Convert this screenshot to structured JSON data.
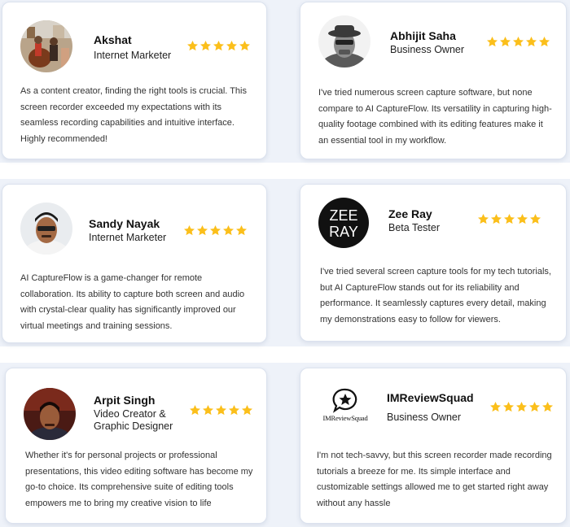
{
  "colors": {
    "star": "#fbbf1b",
    "band": "#eef2f9"
  },
  "testimonials": [
    {
      "name": "Akshat",
      "role": "Internet Marketer",
      "rating": 5,
      "text": "As a content creator, finding the right tools is crucial. This screen recorder exceeded my expectations with its seamless recording capabilities and intuitive interface. Highly recommended!"
    },
    {
      "name": "Abhijit Saha",
      "role": "Business Owner",
      "rating": 5,
      "text": "I've tried numerous screen capture software, but none compare to AI CaptureFlow. Its versatility in capturing high-quality footage combined with its editing features make it an essential tool in my workflow."
    },
    {
      "name": "Sandy Nayak",
      "role": "Internet Marketer",
      "rating": 5,
      "text": "AI CaptureFlow  is a game-changer for remote collaboration. Its ability to capture both screen and audio with crystal-clear quality has significantly improved our virtual meetings and training sessions."
    },
    {
      "name": "Zee Ray",
      "role": "Beta Tester",
      "rating": 5,
      "logo_text": [
        "ZEE",
        "RAY"
      ],
      "text": "I've tried several screen capture tools for my tech tutorials, but AI CaptureFlow stands out for its reliability and performance. It seamlessly captures every detail, making my demonstrations easy to follow for viewers."
    },
    {
      "name": "Arpit Singh",
      "role": "Video Creator & Graphic Designer",
      "rating": 5,
      "text": "Whether it's for personal projects or professional presentations, this video editing software has become my go-to choice. Its comprehensive suite of editing tools empowers me to bring my creative vision to life"
    },
    {
      "name": "IMReviewSquad",
      "role": "Business Owner",
      "rating": 5,
      "logo_text": "IMReviewSquad",
      "text": "I'm not tech-savvy, but this screen recorder made recording tutorials a breeze for me. Its simple interface and customizable settings allowed me to get started right away without any hassle"
    }
  ]
}
